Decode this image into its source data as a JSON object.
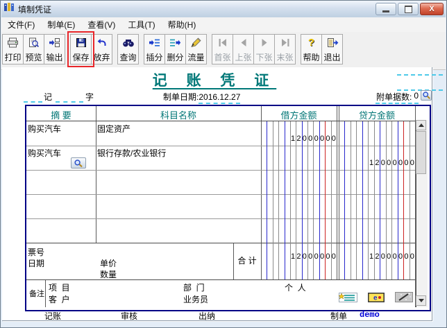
{
  "window": {
    "title": "填制凭证",
    "icon": "ledger-book-icon"
  },
  "menu": [
    {
      "label": "文件(F)"
    },
    {
      "label": "制单(E)"
    },
    {
      "label": "查看(V)"
    },
    {
      "label": "工具(T)"
    },
    {
      "label": "帮助(H)"
    }
  ],
  "toolbar": [
    {
      "label": "打印",
      "icon": "printer-icon",
      "group": 1
    },
    {
      "label": "预览",
      "icon": "preview-icon",
      "group": 1
    },
    {
      "label": "输出",
      "icon": "export-icon",
      "group": 1
    },
    {
      "label": "保存",
      "icon": "save-icon",
      "group": 2,
      "highlight": true
    },
    {
      "label": "放弃",
      "icon": "undo-icon",
      "group": 2
    },
    {
      "label": "查询",
      "icon": "search-icon",
      "group": 3
    },
    {
      "label": "插分",
      "icon": "insert-row-icon",
      "group": 4
    },
    {
      "label": "删分",
      "icon": "delete-row-icon",
      "group": 4
    },
    {
      "label": "流量",
      "icon": "flow-icon",
      "group": 4
    },
    {
      "label": "首张",
      "icon": "first-page-icon",
      "group": 5,
      "disabled": true
    },
    {
      "label": "上张",
      "icon": "prev-page-icon",
      "group": 5,
      "disabled": true
    },
    {
      "label": "下张",
      "icon": "next-page-icon",
      "group": 5,
      "disabled": true
    },
    {
      "label": "末张",
      "icon": "last-page-icon",
      "group": 5,
      "disabled": true
    },
    {
      "label": "帮助",
      "icon": "help-icon",
      "group": 6
    },
    {
      "label": "退出",
      "icon": "exit-icon",
      "group": 6
    }
  ],
  "voucher": {
    "title": "记 账 凭 证",
    "word_left": "记",
    "word_right": "字",
    "date_label": "制单日期:",
    "date_value": "2016.12.27",
    "attach_label": "附单据数:",
    "attach_value": "0",
    "table": {
      "col_summary": "摘 要",
      "col_account": "科目名称",
      "col_debit": "借方金额",
      "col_credit": "贷方金额",
      "rows": [
        {
          "summary": "购买汽车",
          "account": "固定资产",
          "debit": "12000000",
          "credit": ""
        },
        {
          "summary": "购买汽车",
          "account": "银行存款/农业银行",
          "debit": "",
          "credit": "12000000",
          "lookup": true
        },
        {
          "summary": "",
          "account": "",
          "debit": "",
          "credit": ""
        },
        {
          "summary": "",
          "account": "",
          "debit": "",
          "credit": ""
        },
        {
          "summary": "",
          "account": "",
          "debit": "",
          "credit": ""
        }
      ],
      "footer": {
        "ticket_label": "票号",
        "date_label": "日期",
        "unit_price_label": "单价",
        "quantity_label": "数量",
        "total_label": "合 计",
        "debit_total": "12000000",
        "credit_total": "12000000"
      },
      "remarks": {
        "label": "备注",
        "project_label": "项  目",
        "customer_label": "客  户",
        "department_label": "部  门",
        "salesman_label": "业务员",
        "person_label": "个  人"
      }
    },
    "signatures": {
      "bookkeeping_label": "记账",
      "audit_label": "审核",
      "cashier_label": "出纳",
      "prepare_label": "制单",
      "preparer": "demo"
    }
  },
  "colors": {
    "teal": "#007575",
    "navy_border": "#000085",
    "grid_blue": "#2626cc",
    "grid_red": "#cc2222",
    "grid_gray": "#8a8a8a",
    "dash_cyan": "#4cc9e9",
    "highlight_red": "#e8262a",
    "demo_blue": "#0000d8"
  }
}
